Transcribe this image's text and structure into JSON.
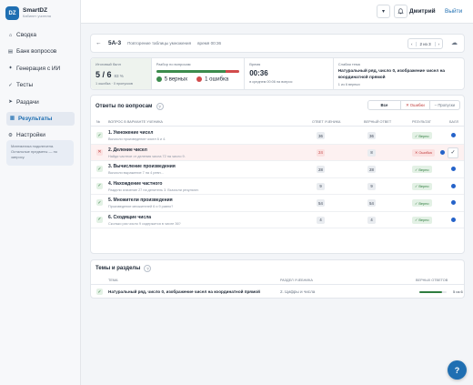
{
  "brand": {
    "logo": "DZ",
    "title": "SmartDZ",
    "subtitle": "Кабинет учителя"
  },
  "sidebar": {
    "items": [
      {
        "label": "Сводка",
        "icon": "home-icon"
      },
      {
        "label": "Банк вопросов",
        "icon": "book-icon"
      },
      {
        "label": "Генерация с ИИ",
        "icon": "sparkle-icon"
      },
      {
        "label": "Тесты",
        "icon": "check-icon"
      },
      {
        "label": "Раздачи",
        "icon": "send-icon"
      },
      {
        "label": "Результаты",
        "icon": "chart-icon",
        "active": true
      },
      {
        "label": "Настройки",
        "icon": "gear-icon"
      }
    ],
    "note": "Математика подключена. Остальные предметы — по запросу."
  },
  "topbar": {
    "menu_glyph": "▾",
    "user": "Дмитрий",
    "logout": "Выйти"
  },
  "crumb": {
    "back": "←",
    "code": "5А-3",
    "title": "Повторение таблицы умножения",
    "time": "время 00:36",
    "pager_prev": "‹",
    "pager": "2 из 3",
    "pager_next": "›"
  },
  "stats": {
    "score_label": "Итоговый балл",
    "score": "5 / 6",
    "score_pct": "83 %",
    "score_note": "1 ошибка · 0 пропусков",
    "breakdown_label": "Разбор по вопросам",
    "correct_value": 5,
    "errors_value": 1,
    "correct_text": "5 верных",
    "errors_text": "1 ошибка",
    "time_label": "Время",
    "time": "00:36",
    "time_note": "в среднем 00:06 на вопрос",
    "weak_label": "Слабая тема",
    "weak_topic": "Натуральный ряд, число 0, изображение чисел на координатной прямой",
    "weak_note": "1 из 6 верных"
  },
  "answers": {
    "title": "Ответы по вопросам",
    "filters": [
      "Все",
      "✕ Ошибки",
      "– Пропуски"
    ],
    "headers": [
      "№",
      "Вопрос в варианте ученика",
      "Ответ ученика",
      "Верный ответ",
      "Результат",
      "Балл"
    ],
    "rows": [
      {
        "title": "1. Умножение чисел",
        "sub": "Вычисли произведение чисел 6 и 4.",
        "student": "36",
        "correct": "36",
        "result": "✓ Верно",
        "status": "ok"
      },
      {
        "title": "2. Деление чисел",
        "sub": "Найди частное от деления числа 72 на число 9.",
        "student": "24",
        "correct": "8",
        "result": "✕ Ошибка",
        "status": "error"
      },
      {
        "title": "3. Вычисление произведения",
        "sub": "Вычисли выражение 7 на 4 ревн...",
        "student": "28",
        "correct": "28",
        "result": "✓ Верно",
        "status": "ok"
      },
      {
        "title": "4. Нахождение частного",
        "sub": "Раздели значение 27 на делитель 3. Вычисли результат.",
        "student": "9",
        "correct": "9",
        "result": "✓ Верно",
        "status": "ok"
      },
      {
        "title": "5. Множители произведения",
        "sub": "Произведение множителей 6 и 9 равно?",
        "student": "54",
        "correct": "54",
        "result": "✓ Верно",
        "status": "ok"
      },
      {
        "title": "6. Сходящие числа",
        "sub": "Сколько раз число 9 содержится в числе 36?",
        "student": "4",
        "correct": "4",
        "result": "✓ Верно",
        "status": "ok"
      }
    ],
    "check_glyph": "✓"
  },
  "topics": {
    "title": "Темы и разделы",
    "headers": [
      "Тема",
      "Раздел учебника",
      "Верных ответов"
    ],
    "rows": [
      {
        "name": "Натуральный ряд, число 0, изображение чисел на координатной прямой",
        "section": "2. Цифры и числа",
        "correct": 5,
        "total": 6,
        "count": "5 из 6"
      }
    ]
  },
  "fab": "?",
  "colors": {
    "accent": "#1f6fb2",
    "ok": "#2f7d3f",
    "error": "#c24141"
  }
}
